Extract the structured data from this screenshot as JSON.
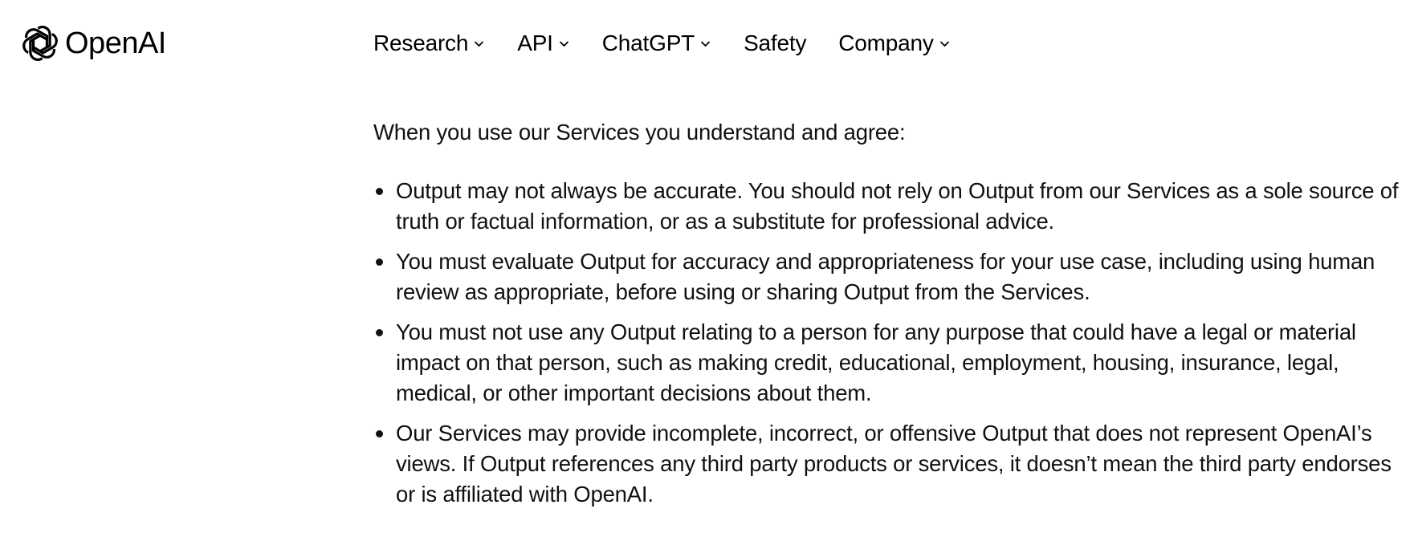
{
  "header": {
    "logo": {
      "icon": "openai-logo-icon",
      "text": "OpenAI"
    },
    "nav": [
      {
        "label": "Research",
        "has_dropdown": true
      },
      {
        "label": "API",
        "has_dropdown": true
      },
      {
        "label": "ChatGPT",
        "has_dropdown": true
      },
      {
        "label": "Safety",
        "has_dropdown": false
      },
      {
        "label": "Company",
        "has_dropdown": true
      }
    ]
  },
  "main": {
    "intro": "When you use our Services you understand and agree:",
    "bullets": [
      "Output may not always be accurate. You should not rely on Output from our Services as a sole source of truth or factual information, or as a substitute for professional advice.",
      "You must evaluate Output for accuracy and appropriateness for your use case, including using human review as appropriate, before using or sharing Output from the Services.",
      "You must not use any Output relating to a person for any purpose that could have a legal or material impact on that person, such as making credit, educational, employment, housing, insurance, legal, medical, or other important decisions about them.",
      "Our Services may provide incomplete, incorrect, or offensive Output that does not represent OpenAI’s views. If Output references any third party products or services, it doesn’t mean the third party endorses or is affiliated with OpenAI."
    ]
  }
}
